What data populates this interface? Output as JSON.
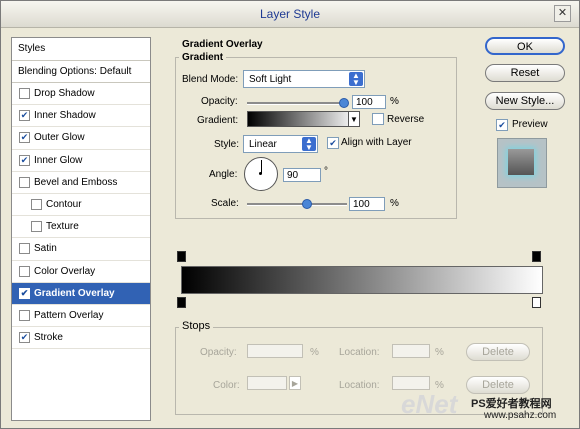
{
  "window": {
    "title": "Layer Style",
    "close_icon": "close-icon"
  },
  "styles": {
    "header": "Styles",
    "blending_default": "Blending Options: Default",
    "items": [
      {
        "label": "Drop Shadow",
        "checked": false,
        "sub": false,
        "selected": false
      },
      {
        "label": "Inner Shadow",
        "checked": true,
        "sub": false,
        "selected": false
      },
      {
        "label": "Outer Glow",
        "checked": true,
        "sub": false,
        "selected": false
      },
      {
        "label": "Inner Glow",
        "checked": true,
        "sub": false,
        "selected": false
      },
      {
        "label": "Bevel and Emboss",
        "checked": false,
        "sub": false,
        "selected": false
      },
      {
        "label": "Contour",
        "checked": false,
        "sub": true,
        "selected": false
      },
      {
        "label": "Texture",
        "checked": false,
        "sub": true,
        "selected": false
      },
      {
        "label": "Satin",
        "checked": false,
        "sub": false,
        "selected": false
      },
      {
        "label": "Color Overlay",
        "checked": false,
        "sub": false,
        "selected": false
      },
      {
        "label": "Gradient Overlay",
        "checked": true,
        "sub": false,
        "selected": true
      },
      {
        "label": "Pattern Overlay",
        "checked": false,
        "sub": false,
        "selected": false
      },
      {
        "label": "Stroke",
        "checked": true,
        "sub": false,
        "selected": false
      }
    ]
  },
  "gradient_overlay": {
    "section_title": "Gradient Overlay",
    "group_title": "Gradient",
    "blend_mode_label": "Blend Mode:",
    "blend_mode_value": "Soft Light",
    "opacity_label": "Opacity:",
    "opacity_value": "100",
    "opacity_unit": "%",
    "gradient_label": "Gradient:",
    "reverse_label": "Reverse",
    "reverse_checked": false,
    "style_label": "Style:",
    "style_value": "Linear",
    "align_label": "Align with Layer",
    "align_checked": true,
    "angle_label": "Angle:",
    "angle_value": "90",
    "angle_unit": "°",
    "scale_label": "Scale:",
    "scale_value": "100",
    "scale_unit": "%"
  },
  "stops": {
    "title": "Stops",
    "opacity_label": "Opacity:",
    "opacity_unit": "%",
    "location_label": "Location:",
    "location_unit": "%",
    "delete_label": "Delete",
    "color_label": "Color:",
    "location2_label": "Location:",
    "location2_unit": "%",
    "delete2_label": "Delete"
  },
  "buttons": {
    "ok": "OK",
    "reset": "Reset",
    "new_style": "New Style...",
    "preview_label": "Preview",
    "preview_checked": true
  },
  "watermark": {
    "brand": "eNet",
    "site_cn": "PS爱好者教程网",
    "site_url": "www.psahz.com"
  }
}
